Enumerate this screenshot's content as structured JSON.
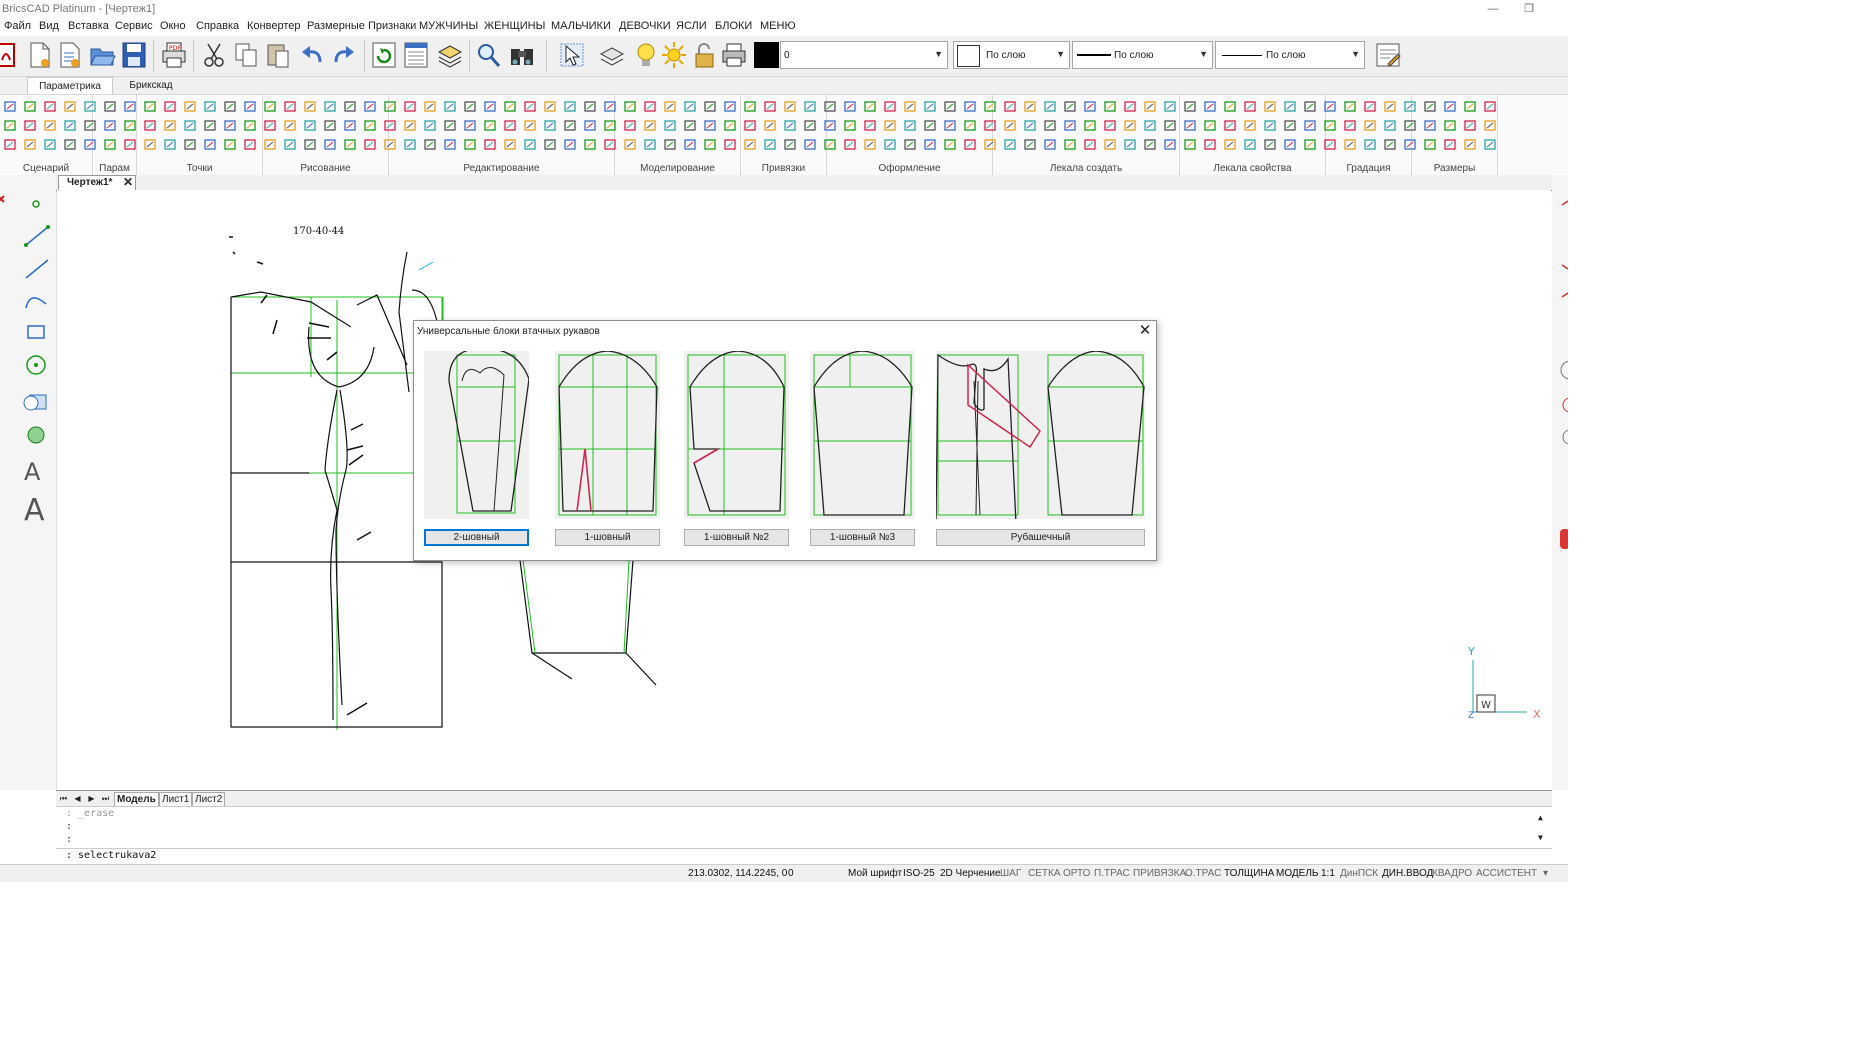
{
  "window": {
    "title": "BricsCAD Platinum - [Чертеж1]"
  },
  "menu": [
    "Файл",
    "Вид",
    "Вставка",
    "Сервис",
    "Окно",
    "Справка",
    "Конвертер",
    "Размерные Признаки",
    "МУЖЧИНЫ",
    "ЖЕНЩИНЫ",
    "МАЛЬЧИКИ",
    "ДЕВОЧКИ",
    "ЯСЛИ",
    "БЛОКИ",
    "МЕНЮ"
  ],
  "toolbar": {
    "layer_value": "0",
    "color_value": "По слою",
    "linetype_value": "По слою",
    "lineweight_value": "По слою"
  },
  "ribbon": {
    "tabs": [
      "Параметрика",
      "Брикскад"
    ],
    "groups": [
      "Сценарий",
      "Парам",
      "Точки",
      "Рисование",
      "Редактирование",
      "Моделирование",
      "Привязки",
      "Оформление",
      "Лекала создать",
      "Лекала свойства",
      "Градация",
      "Размеры"
    ]
  },
  "doc_tab": {
    "label": "Чертеж1*"
  },
  "canvas": {
    "size_label": "170-40-44",
    "ucs_y": "Y",
    "ucs_w": "W",
    "ucs_x": "X",
    "ucs_z": "Z"
  },
  "layout_tabs": [
    "Модель",
    "Лист1",
    "Лист2"
  ],
  "command": {
    "history": [
      ": _erase",
      ":",
      ":"
    ],
    "current": ": selectrukava2"
  },
  "status": {
    "coords": "213.0302, 114.2245, 0",
    "coords_z": "0",
    "items": [
      "Мой шрифт",
      "ISO-25",
      "2D Черчение",
      "ШАГ",
      "СЕТКА",
      "ОРТО",
      "П.ТРАС",
      "ПРИВЯЗКА",
      "О.ТРАС",
      "ТОЛЩИНА",
      "МОДЕЛЬ",
      "1:1",
      "ДинПСК",
      "ДИН.ВВОД",
      "КВАДРО",
      "АССИСТЕНТ"
    ]
  },
  "dialog": {
    "title": "Универсальные блоки втачных рукавов",
    "options": [
      "2-шовный",
      "1-шовный",
      "1-шовный №2",
      "1-шовный №3",
      "Рубашечный"
    ],
    "selected": "2-шовный"
  },
  "colors": {
    "accent": "#0078d7",
    "grid_green": "#1fbf1f",
    "dart_red": "#d3264f"
  }
}
